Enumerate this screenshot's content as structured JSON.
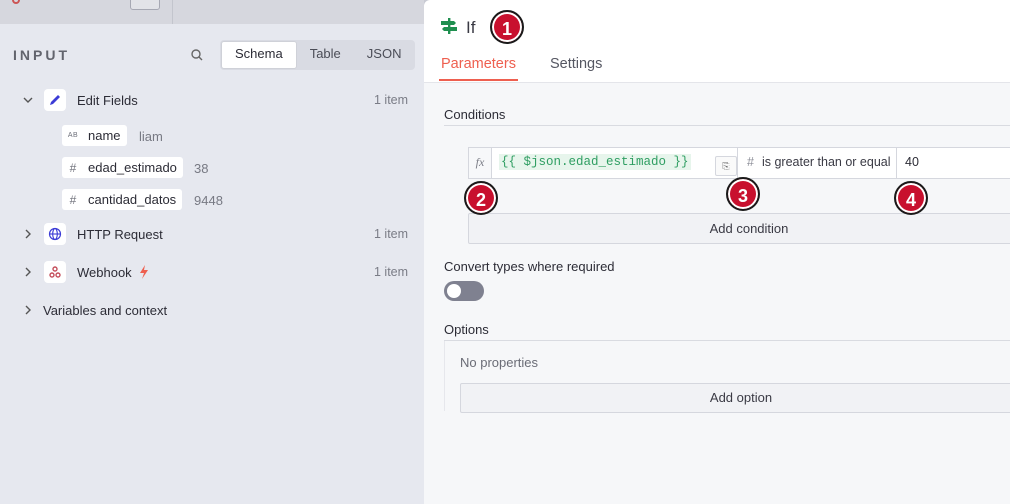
{
  "input_panel": {
    "title": "INPUT",
    "view_tabs": [
      "Schema",
      "Table",
      "JSON"
    ],
    "active_view": "Schema",
    "nodes": [
      {
        "label": "Edit Fields",
        "count": "1 item",
        "icon": "pencil-icon",
        "expanded": true,
        "fields": [
          {
            "type": "AB",
            "name": "name",
            "value": "liam"
          },
          {
            "type": "#",
            "name": "edad_estimado",
            "value": "38"
          },
          {
            "type": "#",
            "name": "cantidad_datos",
            "value": "9448"
          }
        ]
      },
      {
        "label": "HTTP Request",
        "count": "1 item",
        "icon": "globe-icon"
      },
      {
        "label": "Webhook",
        "count": "1 item",
        "icon": "webhook-icon",
        "trigger_icon": "lightning-icon"
      }
    ],
    "variables_label": "Variables and context"
  },
  "node_panel": {
    "title": "If",
    "tabs": [
      "Parameters",
      "Settings"
    ],
    "active_tab": "Parameters",
    "conditions_label": "Conditions",
    "condition": {
      "fx": "fx",
      "left_expression": "{{ $json.edad_estimado }}",
      "type_symbol": "#",
      "operator": "is greater than or equal",
      "right_value": "40"
    },
    "add_condition_label": "Add condition",
    "convert_types_label": "Convert types where required",
    "convert_types_enabled": false,
    "options_label": "Options",
    "no_properties_label": "No properties",
    "add_option_label": "Add option"
  },
  "badges": [
    "1",
    "2",
    "3",
    "4"
  ],
  "colors": {
    "accent": "#ee5f4f",
    "badge": "#c8102e",
    "expression": "#2f9e62",
    "if_icon": "#1f8f4f"
  }
}
